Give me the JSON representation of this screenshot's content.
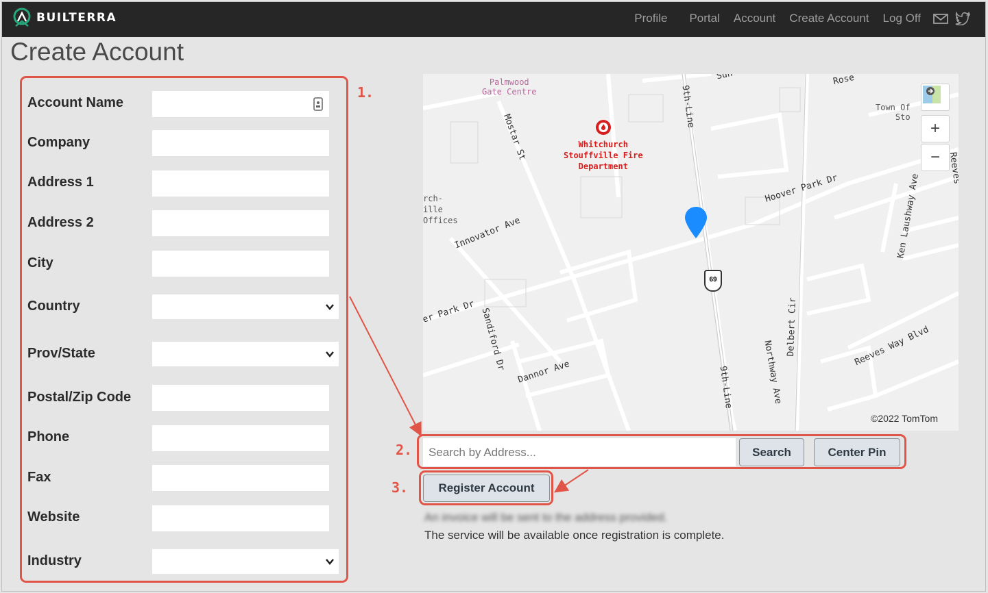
{
  "brand": {
    "name": "BUILTERRA",
    "accent": "#27a87c"
  },
  "nav": {
    "items": [
      "Profile",
      "Portal",
      "Account",
      "Create Account",
      "Log Off"
    ],
    "icons": [
      "mail-icon",
      "twitter-icon"
    ]
  },
  "page": {
    "title": "Create Account"
  },
  "form": {
    "fields": [
      {
        "label": "Account Name",
        "type": "text",
        "value": ""
      },
      {
        "label": "Company",
        "type": "text",
        "value": ""
      },
      {
        "label": "Address 1",
        "type": "text",
        "value": ""
      },
      {
        "label": "Address 2",
        "type": "text",
        "value": ""
      },
      {
        "label": "City",
        "type": "text",
        "value": ""
      },
      {
        "label": "Country",
        "type": "select",
        "value": ""
      },
      {
        "label": "Prov/State",
        "type": "select",
        "value": ""
      },
      {
        "label": "Postal/Zip Code",
        "type": "text",
        "value": ""
      },
      {
        "label": "Phone",
        "type": "text",
        "value": ""
      },
      {
        "label": "Fax",
        "type": "text",
        "value": ""
      },
      {
        "label": "Website",
        "type": "text",
        "value": ""
      },
      {
        "label": "Industry",
        "type": "select",
        "value": ""
      }
    ]
  },
  "annotations": {
    "step1": "1.",
    "step2": "2.",
    "step3": "3.",
    "color": "#e05547"
  },
  "map": {
    "labels": {
      "palmwood": "Palmwood",
      "gate_centre": "Gate Centre",
      "mostar": "Mostar St",
      "whitchurch": "Whitchurch",
      "stouffville_fire": "Stouffville Fire",
      "department": "Department",
      "ninth_line": "9th-Line",
      "sun": "Sun",
      "rose": "Rose",
      "town_of": "Town Of",
      "sto": "Sto",
      "hoover_park": "Hoover Park Dr",
      "ken_laushway": "Ken Laushway Ave",
      "reeves": "Reeves",
      "rch": "rch-",
      "ille": "ille",
      "offices": "Offices",
      "innovator": "Innovator Ave",
      "park_dr": "er Park Dr",
      "sandiford": "Sandiford Dr",
      "dannor": "Dannor Ave",
      "ninth_line_2": "9th-Line",
      "northway": "Northway Ave",
      "delbert": "Delbert Cir",
      "reeves_way": "Reeves Way Blvd",
      "highway": "69",
      "copyright": "©2022 TomTom"
    },
    "controls": {
      "zoom_in": "+",
      "zoom_out": "−"
    },
    "pin_color": "#1a8cff"
  },
  "search": {
    "placeholder": "Search by Address...",
    "value": "",
    "search_label": "Search",
    "center_label": "Center Pin"
  },
  "register": {
    "label": "Register Account"
  },
  "messages": {
    "blurred": "An invoice will be sent to the address provided.",
    "note": "The service will be available once registration is complete."
  }
}
